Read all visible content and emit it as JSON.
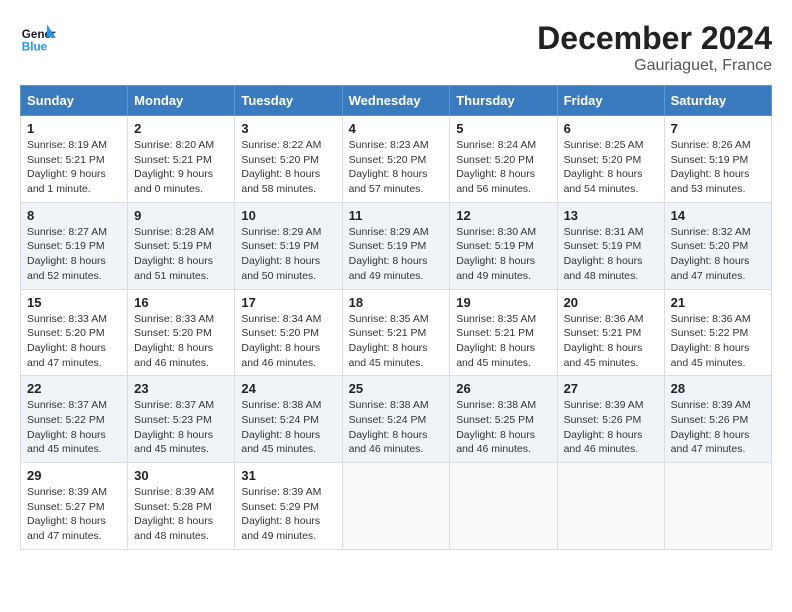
{
  "header": {
    "logo_line1": "General",
    "logo_line2": "Blue",
    "month": "December 2024",
    "location": "Gauriaguet, France"
  },
  "weekdays": [
    "Sunday",
    "Monday",
    "Tuesday",
    "Wednesday",
    "Thursday",
    "Friday",
    "Saturday"
  ],
  "weeks": [
    [
      {
        "day": "1",
        "sunrise": "8:19 AM",
        "sunset": "5:21 PM",
        "daylight": "9 hours and 1 minute."
      },
      {
        "day": "2",
        "sunrise": "8:20 AM",
        "sunset": "5:21 PM",
        "daylight": "9 hours and 0 minutes."
      },
      {
        "day": "3",
        "sunrise": "8:22 AM",
        "sunset": "5:20 PM",
        "daylight": "8 hours and 58 minutes."
      },
      {
        "day": "4",
        "sunrise": "8:23 AM",
        "sunset": "5:20 PM",
        "daylight": "8 hours and 57 minutes."
      },
      {
        "day": "5",
        "sunrise": "8:24 AM",
        "sunset": "5:20 PM",
        "daylight": "8 hours and 56 minutes."
      },
      {
        "day": "6",
        "sunrise": "8:25 AM",
        "sunset": "5:20 PM",
        "daylight": "8 hours and 54 minutes."
      },
      {
        "day": "7",
        "sunrise": "8:26 AM",
        "sunset": "5:19 PM",
        "daylight": "8 hours and 53 minutes."
      }
    ],
    [
      {
        "day": "8",
        "sunrise": "8:27 AM",
        "sunset": "5:19 PM",
        "daylight": "8 hours and 52 minutes."
      },
      {
        "day": "9",
        "sunrise": "8:28 AM",
        "sunset": "5:19 PM",
        "daylight": "8 hours and 51 minutes."
      },
      {
        "day": "10",
        "sunrise": "8:29 AM",
        "sunset": "5:19 PM",
        "daylight": "8 hours and 50 minutes."
      },
      {
        "day": "11",
        "sunrise": "8:29 AM",
        "sunset": "5:19 PM",
        "daylight": "8 hours and 49 minutes."
      },
      {
        "day": "12",
        "sunrise": "8:30 AM",
        "sunset": "5:19 PM",
        "daylight": "8 hours and 49 minutes."
      },
      {
        "day": "13",
        "sunrise": "8:31 AM",
        "sunset": "5:19 PM",
        "daylight": "8 hours and 48 minutes."
      },
      {
        "day": "14",
        "sunrise": "8:32 AM",
        "sunset": "5:20 PM",
        "daylight": "8 hours and 47 minutes."
      }
    ],
    [
      {
        "day": "15",
        "sunrise": "8:33 AM",
        "sunset": "5:20 PM",
        "daylight": "8 hours and 47 minutes."
      },
      {
        "day": "16",
        "sunrise": "8:33 AM",
        "sunset": "5:20 PM",
        "daylight": "8 hours and 46 minutes."
      },
      {
        "day": "17",
        "sunrise": "8:34 AM",
        "sunset": "5:20 PM",
        "daylight": "8 hours and 46 minutes."
      },
      {
        "day": "18",
        "sunrise": "8:35 AM",
        "sunset": "5:21 PM",
        "daylight": "8 hours and 45 minutes."
      },
      {
        "day": "19",
        "sunrise": "8:35 AM",
        "sunset": "5:21 PM",
        "daylight": "8 hours and 45 minutes."
      },
      {
        "day": "20",
        "sunrise": "8:36 AM",
        "sunset": "5:21 PM",
        "daylight": "8 hours and 45 minutes."
      },
      {
        "day": "21",
        "sunrise": "8:36 AM",
        "sunset": "5:22 PM",
        "daylight": "8 hours and 45 minutes."
      }
    ],
    [
      {
        "day": "22",
        "sunrise": "8:37 AM",
        "sunset": "5:22 PM",
        "daylight": "8 hours and 45 minutes."
      },
      {
        "day": "23",
        "sunrise": "8:37 AM",
        "sunset": "5:23 PM",
        "daylight": "8 hours and 45 minutes."
      },
      {
        "day": "24",
        "sunrise": "8:38 AM",
        "sunset": "5:24 PM",
        "daylight": "8 hours and 45 minutes."
      },
      {
        "day": "25",
        "sunrise": "8:38 AM",
        "sunset": "5:24 PM",
        "daylight": "8 hours and 46 minutes."
      },
      {
        "day": "26",
        "sunrise": "8:38 AM",
        "sunset": "5:25 PM",
        "daylight": "8 hours and 46 minutes."
      },
      {
        "day": "27",
        "sunrise": "8:39 AM",
        "sunset": "5:26 PM",
        "daylight": "8 hours and 46 minutes."
      },
      {
        "day": "28",
        "sunrise": "8:39 AM",
        "sunset": "5:26 PM",
        "daylight": "8 hours and 47 minutes."
      }
    ],
    [
      {
        "day": "29",
        "sunrise": "8:39 AM",
        "sunset": "5:27 PM",
        "daylight": "8 hours and 47 minutes."
      },
      {
        "day": "30",
        "sunrise": "8:39 AM",
        "sunset": "5:28 PM",
        "daylight": "8 hours and 48 minutes."
      },
      {
        "day": "31",
        "sunrise": "8:39 AM",
        "sunset": "5:29 PM",
        "daylight": "8 hours and 49 minutes."
      },
      null,
      null,
      null,
      null
    ]
  ],
  "labels": {
    "sunrise": "Sunrise:",
    "sunset": "Sunset:",
    "daylight": "Daylight:"
  }
}
